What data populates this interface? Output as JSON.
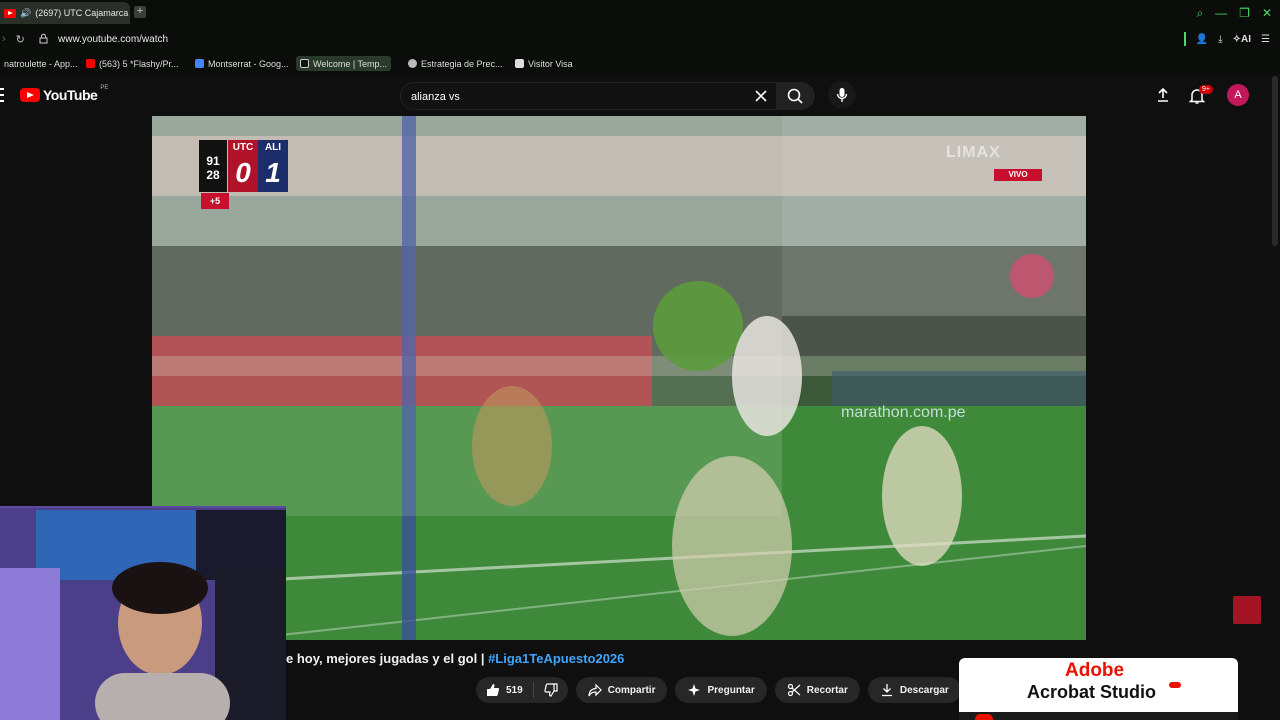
{
  "browser": {
    "tab_title": "(2697) UTC Cajamarca",
    "new_tab": "+",
    "url": "www.youtube.com/watch",
    "ai_label": "AI",
    "bookmarks": [
      {
        "label": "natroulette - App...",
        "color": "#f3a93c"
      },
      {
        "label": "(563) 5 *Flashy/Pr...",
        "color": "#ff0000"
      },
      {
        "label": "Montserrat - Goog...",
        "color": "#4285f4"
      },
      {
        "label": "Welcome | Temp...",
        "color": "#111111"
      },
      {
        "label": "Estrategia de Prec...",
        "color": "#bbbbbb"
      },
      {
        "label": "Visitor Visa",
        "color": "#dddddd"
      }
    ]
  },
  "youtube": {
    "logo_text": "YouTube",
    "country_code": "PE",
    "search_value": "alianza vs",
    "notification_count": "9+",
    "avatar_letter": "A"
  },
  "video": {
    "scorebug": {
      "time_top": "91",
      "time_bottom": "28",
      "home_abbr": "UTC",
      "home_score": "0",
      "away_abbr": "ALI",
      "away_score": "1",
      "added_time": "+5"
    },
    "live_label": "VIVO",
    "watermark": "LIMAX",
    "ad_text": "marathon.com.pe",
    "title_main": "e hoy, mejores jugadas y el gol | ",
    "title_tag": "#Liga1TeApuesto2026"
  },
  "actions": {
    "likes": "519",
    "share": "Compartir",
    "ask": "Preguntar",
    "clip": "Recortar",
    "download": "Descargar",
    "more": "···"
  },
  "ad": {
    "brand": "Adobe",
    "product": "Acrobat Studio"
  },
  "colors": {
    "accent_red": "#ff0000",
    "link_blue": "#3ea6ff",
    "browser_green": "#4cd964"
  }
}
